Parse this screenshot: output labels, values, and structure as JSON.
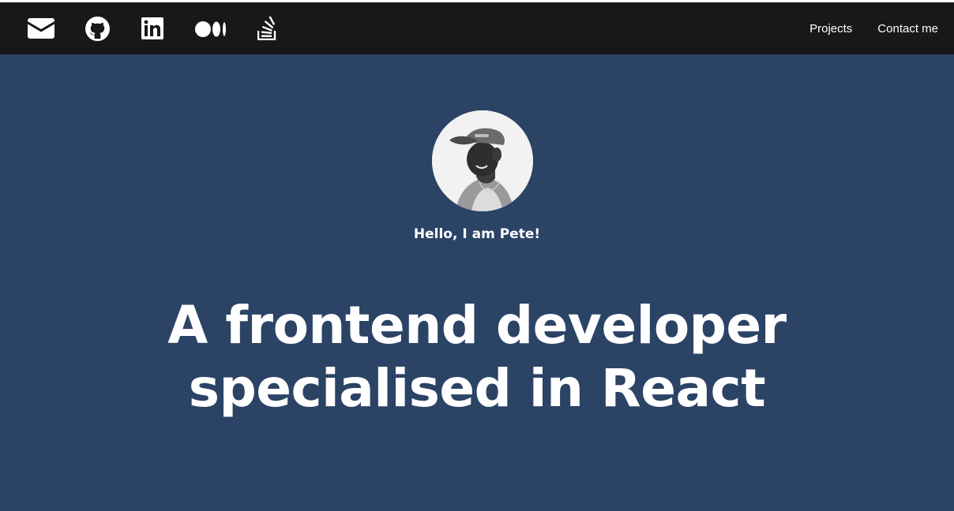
{
  "navbar": {
    "social_icons": [
      {
        "icon": "envelope-icon",
        "label": "Email"
      },
      {
        "icon": "github-icon",
        "label": "GitHub"
      },
      {
        "icon": "linkedin-icon",
        "label": "LinkedIn"
      },
      {
        "icon": "medium-icon",
        "label": "Medium"
      },
      {
        "icon": "stackoverflow-icon",
        "label": "Stack Overflow"
      }
    ],
    "links": [
      "Projects",
      "Contact me"
    ]
  },
  "hero": {
    "greeting": "Hello, I am Pete!",
    "headline_line1": "A frontend developer",
    "headline_line2": "specialised in React"
  },
  "colors": {
    "navbar_bg": "#18181b",
    "hero_bg": "#2b4365",
    "text": "#ffffff"
  }
}
